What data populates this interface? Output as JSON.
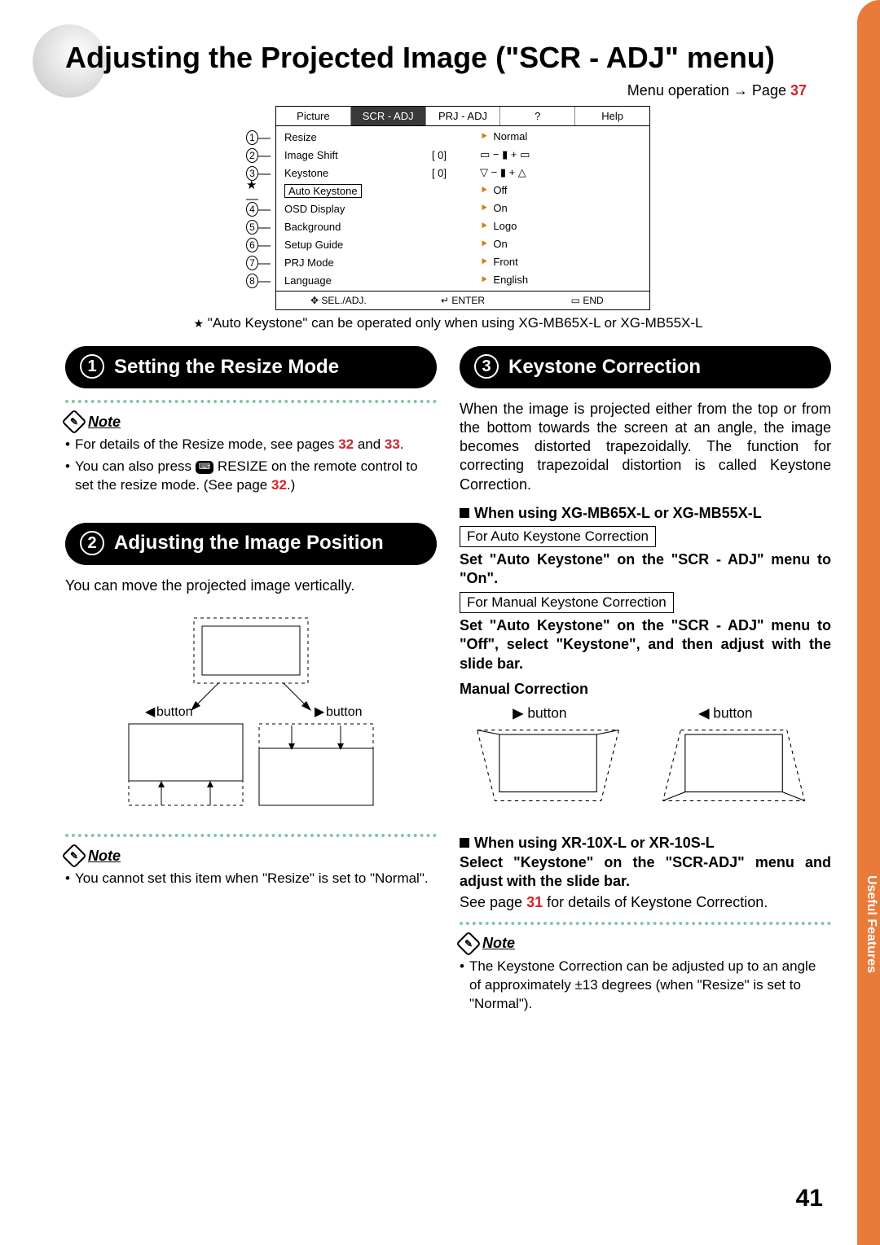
{
  "title": "Adjusting the Projected Image (\"SCR - ADJ\" menu)",
  "menu_operation": {
    "prefix": "Menu operation",
    "page": "37"
  },
  "menu": {
    "tabs": [
      "Picture",
      "SCR - ADJ",
      "PRJ - ADJ",
      "?",
      "Help"
    ],
    "active_tab": 1,
    "rows": [
      {
        "n": "1",
        "label": "Resize",
        "mid": "",
        "arrow": true,
        "val": "Normal"
      },
      {
        "n": "2",
        "label": "Image Shift",
        "mid": "[    0]",
        "arrow": false,
        "val": "▭ −  ▮  + ▭"
      },
      {
        "n": "3",
        "label": "Keystone",
        "mid": "[    0]",
        "arrow": false,
        "val": "▽ −  ▮  + △"
      },
      {
        "n": "★",
        "label": "Auto Keystone",
        "mid": "",
        "arrow": true,
        "val": "Off"
      },
      {
        "n": "4",
        "label": "OSD Display",
        "mid": "",
        "arrow": true,
        "val": "On"
      },
      {
        "n": "5",
        "label": "Background",
        "mid": "",
        "arrow": true,
        "val": "Logo"
      },
      {
        "n": "6",
        "label": "Setup Guide",
        "mid": "",
        "arrow": true,
        "val": "On"
      },
      {
        "n": "7",
        "label": "PRJ Mode",
        "mid": "",
        "arrow": true,
        "val": "Front"
      },
      {
        "n": "8",
        "label": "Language",
        "mid": "",
        "arrow": true,
        "val": "English"
      }
    ],
    "footer": [
      "✥ SEL./ADJ.",
      "↵ ENTER",
      "▭ END"
    ]
  },
  "footnote": "\"Auto Keystone\" can be operated only when using XG-MB65X-L or XG-MB55X-L",
  "sec1": {
    "heading": "Setting the Resize Mode",
    "note_label": "Note",
    "bullets": [
      {
        "pre": "For details of the Resize mode, see pages ",
        "link1": "32",
        "mid": " and ",
        "link2": "33",
        "post": "."
      },
      {
        "pre": "You can also press ",
        "btn": "⌨",
        "mid": " RESIZE on the remote control to set the resize mode. (See page ",
        "link1": "32",
        "post": ".)"
      }
    ]
  },
  "sec2": {
    "heading": "Adjusting the Image Position",
    "body": "You can move the projected image vertically.",
    "btn_left": "◀ button",
    "btn_right": "▶ button",
    "note_label": "Note",
    "bullet": "You cannot set this item when \"Resize\" is set to \"Normal\"."
  },
  "sec3": {
    "heading": "Keystone Correction",
    "intro": "When the image is projected either from the top or from the bottom towards the screen at an angle, the image becomes distorted trapezoidally. The function for correcting trapezoidal distortion is called Keystone Correction.",
    "h_a": "When using XG-MB65X-L or XG-MB55X-L",
    "box_auto": "For Auto Keystone Correction",
    "auto_text": "Set \"Auto Keystone\" on the \"SCR - ADJ\" menu to \"On\".",
    "box_manual": "For Manual Keystone Correction",
    "manual_text": "Set \"Auto Keystone\" on the \"SCR - ADJ\" menu to \"Off\", select \"Keystone\", and then adjust with the slide bar.",
    "manual_corr": "Manual Correction",
    "btn_right": "▶ button",
    "btn_left": "◀ button",
    "h_b": "When using XR-10X-L or XR-10S-L",
    "b_text": "Select \"Keystone\" on the \"SCR-ADJ\" menu and adjust with the slide bar.",
    "see_page": {
      "pre": "See page ",
      "link": "31",
      "post": " for details of Keystone Correction."
    },
    "note_label": "Note",
    "note_bullet": "The Keystone Correction can be adjusted up to an angle of approximately ±13 degrees (when \"Resize\" is set to \"Normal\")."
  },
  "side_tab": "Useful Features",
  "page_number": "41"
}
